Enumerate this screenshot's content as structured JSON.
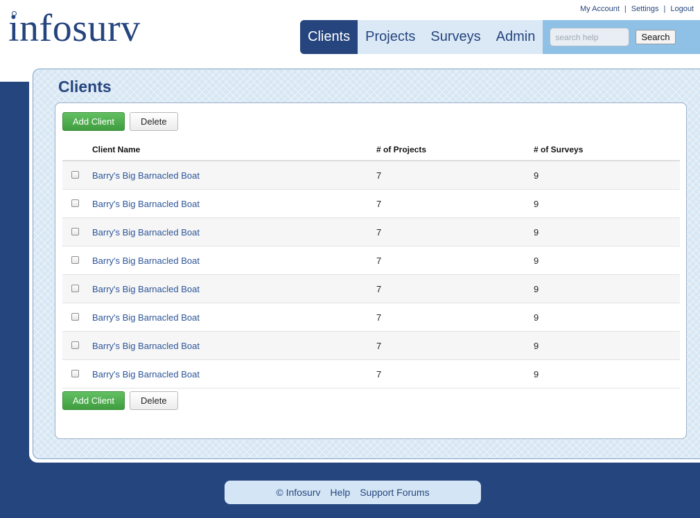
{
  "brand": {
    "logo_text": "infosurv"
  },
  "util_links": [
    {
      "label": "My Account"
    },
    {
      "label": "Settings"
    },
    {
      "label": "Logout"
    }
  ],
  "nav": {
    "tabs": [
      {
        "label": "Clients",
        "active": true
      },
      {
        "label": "Projects",
        "active": false
      },
      {
        "label": "Surveys",
        "active": false
      },
      {
        "label": "Admin",
        "active": false
      }
    ],
    "search_placeholder": "search help",
    "search_button": "Search"
  },
  "page": {
    "title": "Clients",
    "add_button": "Add Client",
    "delete_button": "Delete"
  },
  "table": {
    "columns": [
      "Client Name",
      "# of Projects",
      "# of Surveys"
    ],
    "rows": [
      {
        "name": "Barry's Big Barnacled Boat",
        "projects": "7",
        "surveys": "9"
      },
      {
        "name": "Barry's Big Barnacled Boat",
        "projects": "7",
        "surveys": "9"
      },
      {
        "name": "Barry's Big Barnacled Boat",
        "projects": "7",
        "surveys": "9"
      },
      {
        "name": "Barry's Big Barnacled Boat",
        "projects": "7",
        "surveys": "9"
      },
      {
        "name": "Barry's Big Barnacled Boat",
        "projects": "7",
        "surveys": "9"
      },
      {
        "name": "Barry's Big Barnacled Boat",
        "projects": "7",
        "surveys": "9"
      },
      {
        "name": "Barry's Big Barnacled Boat",
        "projects": "7",
        "surveys": "9"
      },
      {
        "name": "Barry's Big Barnacled Boat",
        "projects": "7",
        "surveys": "9"
      }
    ]
  },
  "footer": {
    "copyright": "© Infosurv",
    "help": "Help",
    "forums": "Support Forums"
  },
  "colors": {
    "brand_navy": "#26457e",
    "nav_light": "#a7c9e8",
    "success_green": "#4caf50"
  }
}
